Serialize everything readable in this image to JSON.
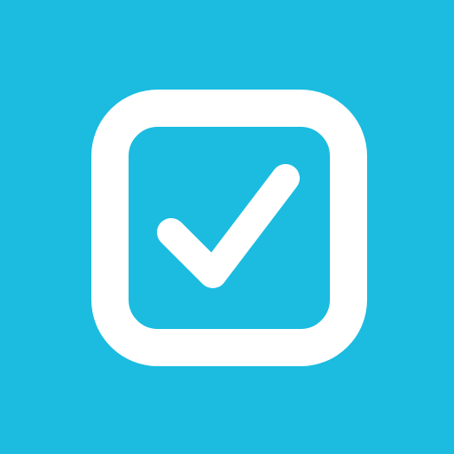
{
  "icon": {
    "name": "checkbox-checked-icon",
    "state": "checked",
    "colors": {
      "background": "#1bbce0",
      "foreground": "#ffffff"
    }
  }
}
